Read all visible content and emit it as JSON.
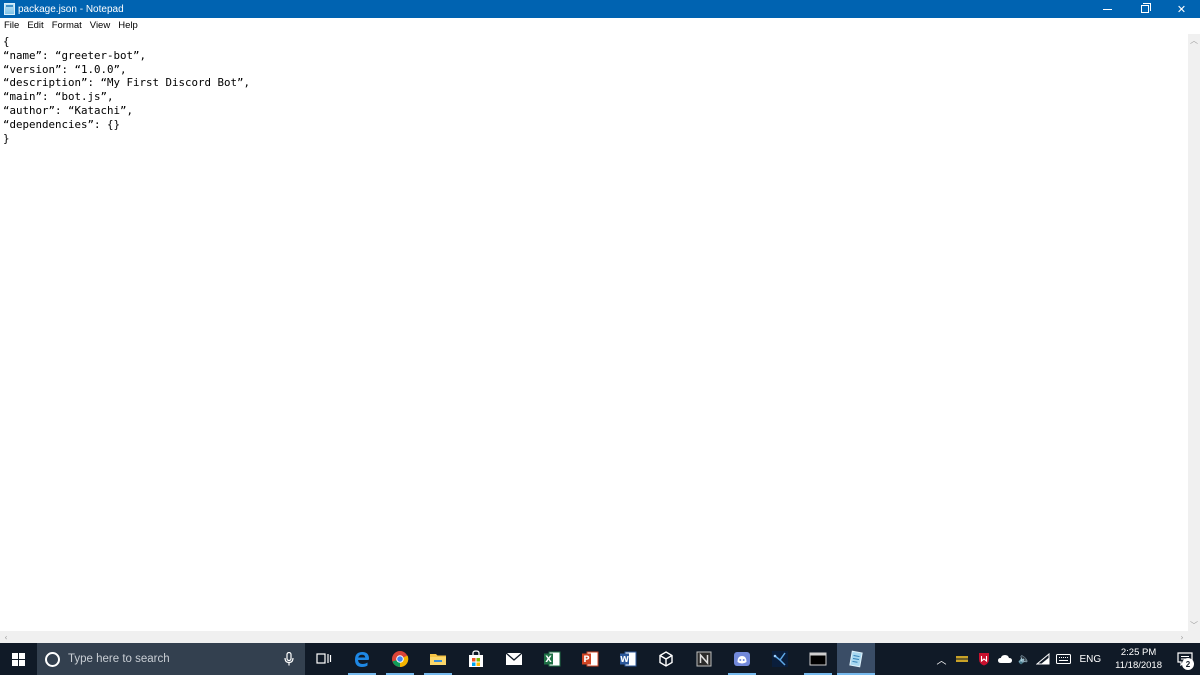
{
  "window": {
    "title": "package.json - Notepad"
  },
  "menu": {
    "items": [
      "File",
      "Edit",
      "Format",
      "View",
      "Help"
    ]
  },
  "editor": {
    "lines": [
      "{",
      "“name”: “greeter-bot”,",
      "“version”: “1.0.0”,",
      "“description”: “My First Discord Bot”,",
      "“main”: “bot.js”,",
      "“author”: “Katachi”,",
      "“dependencies”: {}",
      "}"
    ]
  },
  "taskbar": {
    "search_placeholder": "Type here to search",
    "pinned_apps": [
      {
        "name": "task-view-icon"
      },
      {
        "name": "edge-icon",
        "color": "#1e88e5"
      },
      {
        "name": "chrome-icon"
      },
      {
        "name": "file-explorer-icon",
        "color": "#f6c344"
      },
      {
        "name": "store-icon"
      },
      {
        "name": "mail-icon"
      },
      {
        "name": "excel-icon",
        "color": "#1e7145"
      },
      {
        "name": "powerpoint-icon",
        "color": "#d04423"
      },
      {
        "name": "word-icon",
        "color": "#2b579a"
      },
      {
        "name": "unity-icon"
      },
      {
        "name": "notion-icon"
      },
      {
        "name": "discord-icon",
        "color": "#7289da"
      },
      {
        "name": "visual-studio-icon"
      },
      {
        "name": "terminal-icon"
      },
      {
        "name": "notepad-icon"
      }
    ],
    "tray": {
      "language": "ENG",
      "time": "2:25 PM",
      "date": "11/18/2018",
      "notification_count": "2"
    }
  },
  "colors": {
    "titlebar": "#0063b1",
    "taskbar": "#101a27",
    "search_box": "#33404f"
  }
}
